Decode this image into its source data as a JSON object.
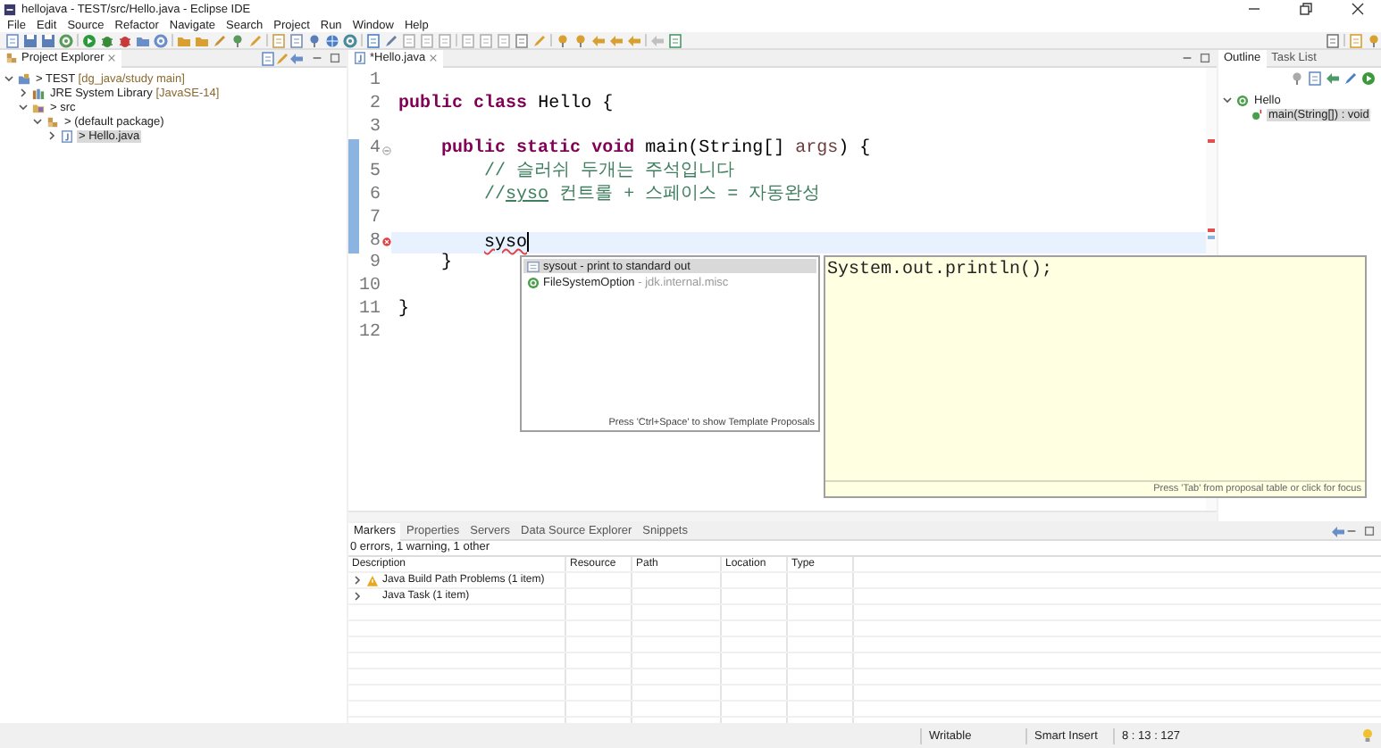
{
  "window": {
    "title": "hellojava - TEST/src/Hello.java - Eclipse IDE"
  },
  "menu": [
    "File",
    "Edit",
    "Source",
    "Refactor",
    "Navigate",
    "Search",
    "Project",
    "Run",
    "Window",
    "Help"
  ],
  "project_explorer": {
    "title": "Project Explorer",
    "tree": [
      {
        "label": "> TEST",
        "decoration": "[dg_java/study main]",
        "kind": "project",
        "expanded": true,
        "selected": false,
        "children": [
          {
            "label": "JRE System Library",
            "decoration": "[JavaSE-14]",
            "kind": "library",
            "expanded": false,
            "selected": false
          },
          {
            "label": "> src",
            "kind": "folder",
            "expanded": true,
            "selected": false,
            "children": [
              {
                "label": "> (default package)",
                "kind": "package",
                "expanded": true,
                "selected": false,
                "children": [
                  {
                    "label": "> Hello.java",
                    "kind": "file",
                    "expanded": false,
                    "selected": true
                  }
                ]
              }
            ]
          }
        ]
      }
    ]
  },
  "editor": {
    "tab": "*Hello.java",
    "lines": [
      {
        "number": "1",
        "kind": "plain",
        "changed": false,
        "current": false
      },
      {
        "number": "2",
        "kind": "plain",
        "changed": false,
        "current": false,
        "tokens": [
          {
            "text": "public",
            "kind": "keyword"
          },
          {
            "text": " class",
            "kind": "keyword"
          },
          {
            "text": " Hello {",
            "kind": "plain"
          }
        ]
      },
      {
        "number": "3",
        "kind": "plain",
        "changed": false,
        "current": false
      },
      {
        "number": "4",
        "kind": "fold",
        "changed": true,
        "current": false,
        "tokens": [
          {
            "text": "    public",
            "kind": "keyword"
          },
          {
            "text": " static",
            "kind": "keyword"
          },
          {
            "text": " void",
            "kind": "keyword"
          },
          {
            "text": " main(String[] ",
            "kind": "plain"
          },
          {
            "text": "args",
            "kind": "param"
          },
          {
            "text": ") {",
            "kind": "plain"
          }
        ]
      },
      {
        "number": "5",
        "kind": "plain",
        "changed": true,
        "current": false,
        "tokens": [
          {
            "text": "        // 슬러쉬 두개는 주석입니다",
            "kind": "comment"
          }
        ]
      },
      {
        "number": "6",
        "kind": "plain",
        "changed": true,
        "current": false,
        "tokens": [
          {
            "text": "        //",
            "kind": "comment"
          },
          {
            "text": "syso",
            "kind": "spelling"
          },
          {
            "text": " 컨트롤 + 스페이스 = 자동완성",
            "kind": "comment"
          }
        ]
      },
      {
        "number": "7",
        "kind": "plain",
        "changed": true,
        "current": false
      },
      {
        "number": "8",
        "kind": "error",
        "changed": true,
        "current": true,
        "tokens": [
          {
            "text": "        syso",
            "kind": "error"
          }
        ]
      },
      {
        "number": "9",
        "kind": "plain",
        "changed": false,
        "current": false,
        "tokens": [
          {
            "text": "    }",
            "kind": "plain"
          }
        ]
      },
      {
        "number": "10",
        "kind": "plain",
        "changed": false,
        "current": false
      },
      {
        "number": "11",
        "kind": "plain",
        "changed": false,
        "current": false,
        "tokens": [
          {
            "text": "}",
            "kind": "plain"
          }
        ]
      },
      {
        "number": "12",
        "kind": "plain",
        "changed": false,
        "current": false
      }
    ]
  },
  "content_assist": {
    "proposals": [
      {
        "label": "sysout - print to standard out",
        "kind": "template",
        "selected": true
      },
      {
        "label": "FileSystemOption",
        "detail": "- jdk.internal.misc",
        "kind": "class",
        "selected": false
      }
    ],
    "footer": "Press 'Ctrl+Space' to show Template Proposals",
    "preview": "System.out.println();",
    "preview_footer": "Press 'Tab' from proposal table or click for focus"
  },
  "outline": {
    "tabs": [
      {
        "label": "Outline",
        "selected": true
      },
      {
        "label": "Task List",
        "selected": false
      }
    ],
    "tree": [
      {
        "label": "Hello",
        "kind": "class",
        "expanded": true,
        "selected": false,
        "children": [
          {
            "label": "main(String[]) : void",
            "kind": "method",
            "selected": true
          }
        ]
      }
    ]
  },
  "bottom_panel": {
    "tabs": [
      {
        "label": "Markers",
        "selected": true
      },
      {
        "label": "Properties",
        "selected": false
      },
      {
        "label": "Servers",
        "selected": false
      },
      {
        "label": "Data Source Explorer",
        "selected": false
      },
      {
        "label": "Snippets",
        "selected": false
      }
    ],
    "summary": "0 errors, 1 warning, 1 other",
    "columns": [
      "Description",
      "Resource",
      "Path",
      "Location",
      "Type"
    ],
    "rows": [
      {
        "description": "Java Build Path Problems (1 item)",
        "kind": "warning",
        "expanded": false
      },
      {
        "description": "Java Task (1 item)",
        "kind": "task",
        "expanded": false
      }
    ]
  },
  "status_bar": [
    "Writable",
    "Smart Insert",
    "8 : 13 : 127"
  ]
}
